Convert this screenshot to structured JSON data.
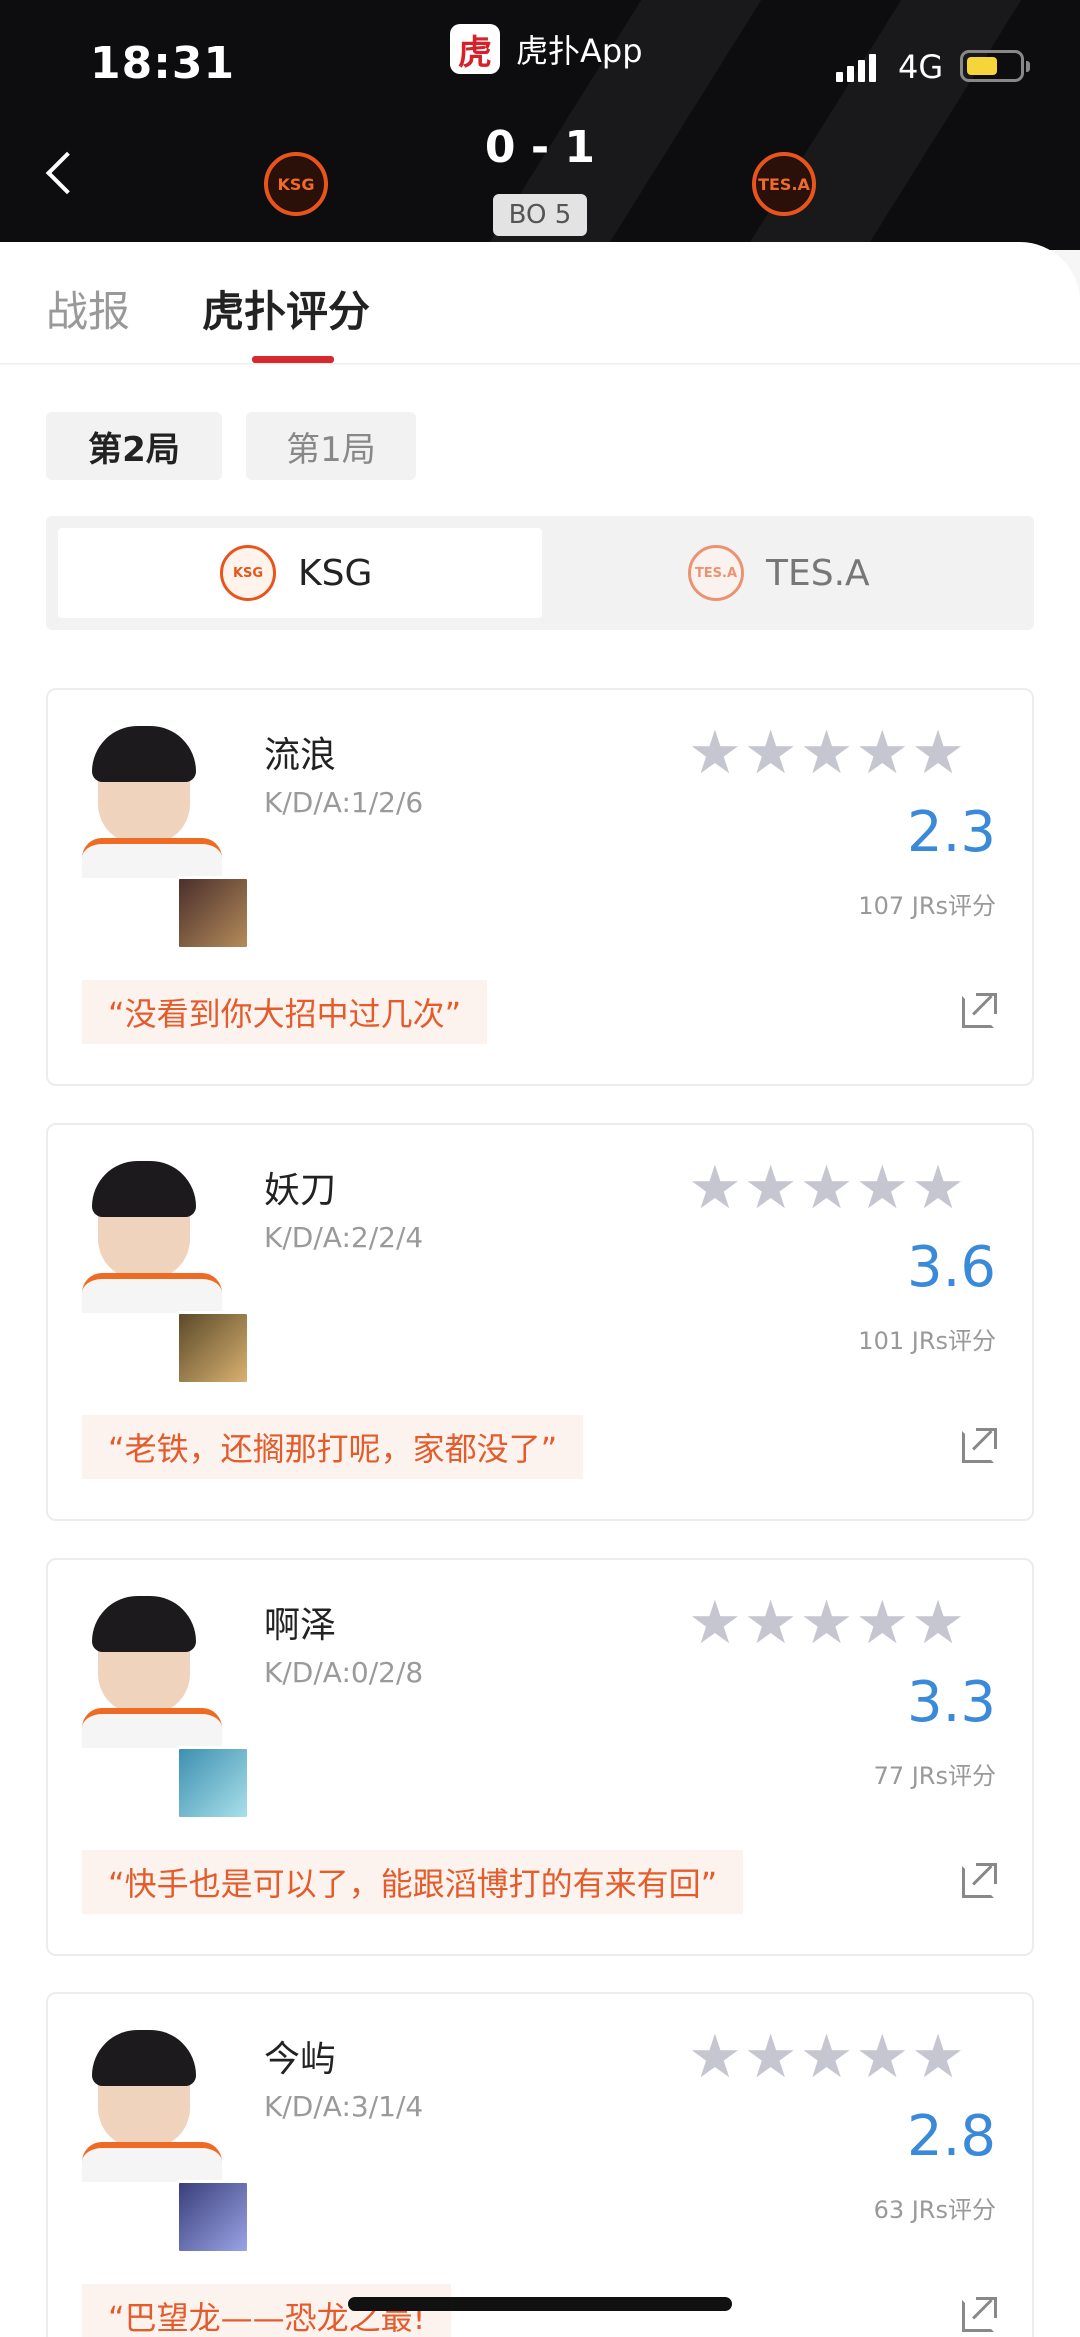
{
  "status_bar": {
    "time": "18:31",
    "network": "4G",
    "app_badge": {
      "logo_text": "虎",
      "label": "虎扑App"
    }
  },
  "match": {
    "score": "0 - 1",
    "format": "BO 5",
    "home_team_logo_text": "KSG",
    "away_team_logo_text": "TES.A"
  },
  "tabs": [
    {
      "label": "战报"
    },
    {
      "label": "虎扑评分"
    }
  ],
  "game_buttons": [
    {
      "label": "第2局"
    },
    {
      "label": "第1局"
    }
  ],
  "team_switch": [
    {
      "name": "KSG",
      "logo_text": "KSG"
    },
    {
      "name": "TES.A",
      "logo_text": "TES.A"
    }
  ],
  "stars_glyph": "★★★★★",
  "players": [
    {
      "name": "流浪",
      "kda": "K/D/A:1/2/6",
      "score": "2.3",
      "ratings": "107 JRs评分",
      "quote": "“没看到你大招中过几次”"
    },
    {
      "name": "妖刀",
      "kda": "K/D/A:2/2/4",
      "score": "3.6",
      "ratings": "101 JRs评分",
      "quote": "“老铁，还搁那打呢，家都没了”"
    },
    {
      "name": "啊泽",
      "kda": "K/D/A:0/2/8",
      "score": "3.3",
      "ratings": "77 JRs评分",
      "quote": "“快手也是可以了，能跟滔博打的有来有回”"
    },
    {
      "name": "今屿",
      "kda": "K/D/A:3/1/4",
      "score": "2.8",
      "ratings": "63 JRs评分",
      "quote": "“巴望龙——恐龙之最!"
    }
  ]
}
